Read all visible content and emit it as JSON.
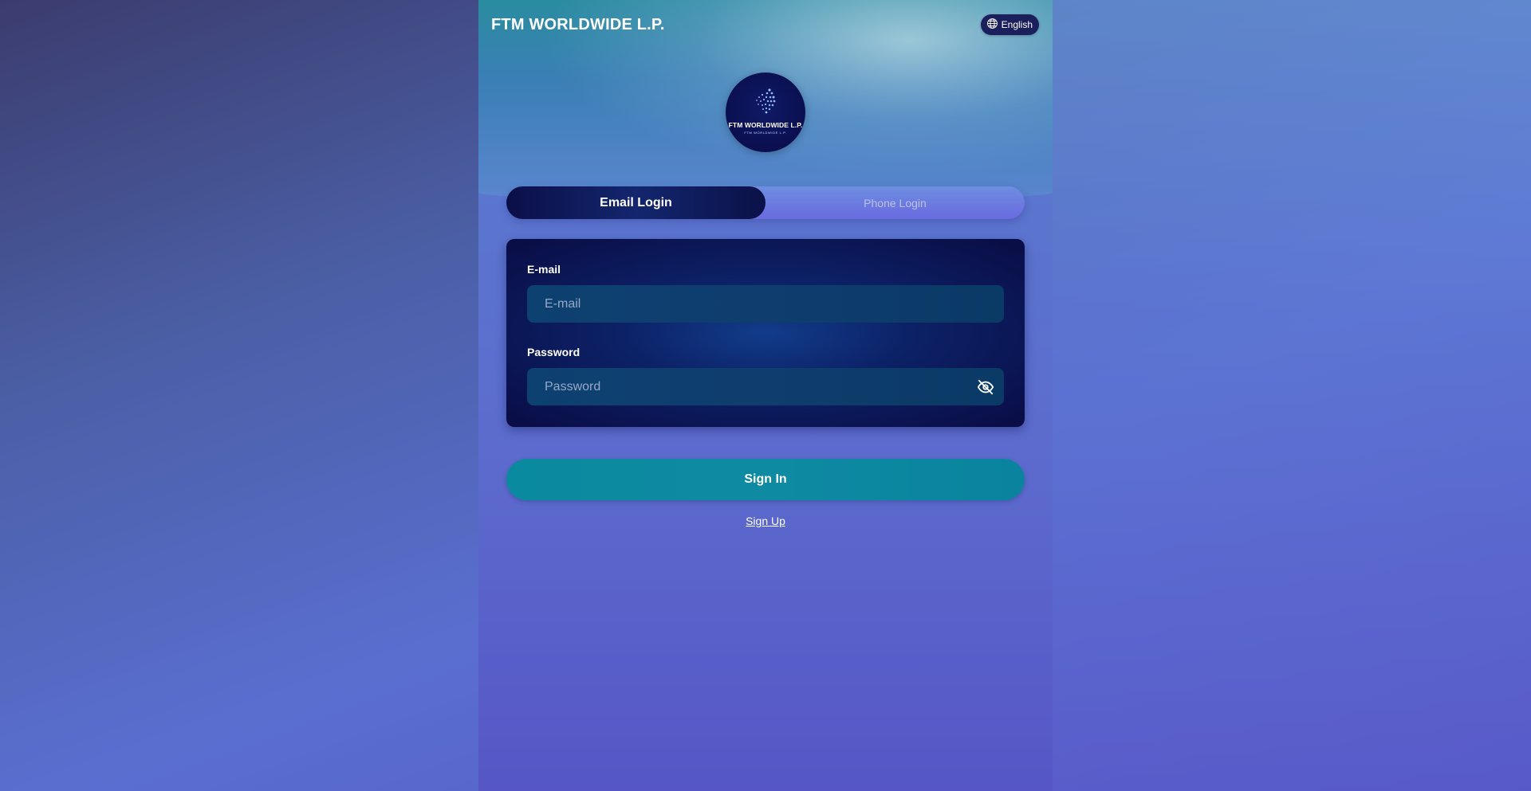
{
  "header": {
    "brand": "FTM WORLDWIDE L.P.",
    "language_label": "English",
    "language_icon": "globe-icon"
  },
  "logo": {
    "text": "FTM WORLDWIDE L.P.",
    "subtext": "FTM WORLDWIDE L.P."
  },
  "tabs": [
    {
      "label": "Email Login",
      "active": true
    },
    {
      "label": "Phone Login",
      "active": false
    }
  ],
  "form": {
    "email_label": "E-mail",
    "email_placeholder": "E-mail",
    "email_value": "",
    "password_label": "Password",
    "password_placeholder": "Password",
    "password_value": "",
    "password_toggle_icon": "eye-off-icon"
  },
  "actions": {
    "sign_in_label": "Sign In",
    "sign_up_label": "Sign Up"
  },
  "colors": {
    "primary_button": "#0a8a9e",
    "tab_active": "#0b0f48",
    "card_bg": "#0a0c44"
  }
}
